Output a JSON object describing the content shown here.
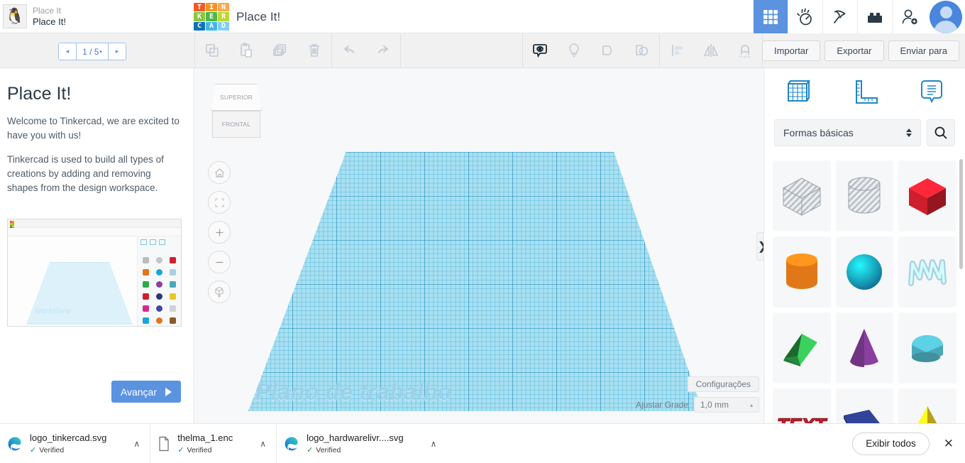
{
  "header": {
    "project_owner": "Place It",
    "project_name": "Place It!",
    "brand_letters": [
      "T",
      "I",
      "N",
      "K",
      "E",
      "R",
      "C",
      "A",
      "D"
    ],
    "brand_colors": [
      "#f15a29",
      "#f7941e",
      "#f9a94b",
      "#8cc63f",
      "#4db848",
      "#bed630",
      "#0d72b9",
      "#41b6e6",
      "#7fd0f0"
    ],
    "brand_title": "Place It!",
    "icons": [
      {
        "name": "grid-apps-icon",
        "active": true
      },
      {
        "name": "circuits-icon",
        "active": false
      },
      {
        "name": "codeblocks-pickaxe-icon",
        "active": false
      },
      {
        "name": "brick-icon",
        "active": false
      },
      {
        "name": "add-user-icon",
        "active": false
      },
      {
        "name": "user-avatar",
        "active": false
      }
    ]
  },
  "toolbar": {
    "pager": {
      "prev": "◂",
      "label": "1 / 5",
      "caret": "▾",
      "next": "▸"
    },
    "left_tools": [
      "copy-icon",
      "paste-icon",
      "duplicate-icon",
      "delete-icon"
    ],
    "history_tools": [
      "undo-icon",
      "redo-icon"
    ],
    "right_tools": [
      "show-hide-eye-icon",
      "lightbulb-icon",
      "group-icon",
      "ungroup-icon",
      "align-icon",
      "mirror-icon",
      "magnet-icon"
    ],
    "import_label": "Importar",
    "export_label": "Exportar",
    "send_to_label": "Enviar para"
  },
  "tutorial": {
    "title": "Place It!",
    "paragraph1": "Welcome to Tinkercad, we are excited to have you with us!",
    "paragraph2": "Tinkercad is used to build all types of creations by adding and removing shapes from the design workspace.",
    "thumbnail_workplane_label": "Workplane",
    "advance_label": "Avançar"
  },
  "canvas": {
    "viewcube_top": "SUPERIOR",
    "viewcube_front": "FRONTAL",
    "nav_buttons": [
      "home-icon",
      "fit-view-icon",
      "zoom-in-icon",
      "zoom-out-icon",
      "orthographic-view-icon"
    ],
    "workplane_label": "Plano de trabalho",
    "settings_label": "Configurações",
    "grid_label": "Ajustar Grade",
    "grid_value": "1,0 mm",
    "grid_caret": "▴",
    "grid_color": "#a9e0f2"
  },
  "right_panel": {
    "tabs": [
      "workplane-grid-icon",
      "ruler-icon",
      "notes-icon"
    ],
    "category_value": "Formas básicas",
    "search_icon": "search-icon",
    "collapse_icon": "❯",
    "shapes": [
      {
        "name": "box-hole",
        "color": "#c9cdd1",
        "kind": "box",
        "hatched": true
      },
      {
        "name": "cylinder-hole",
        "color": "#c9cdd1",
        "kind": "cylinder",
        "hatched": true
      },
      {
        "name": "box-red",
        "color": "#cf1f2e",
        "kind": "box",
        "hatched": false
      },
      {
        "name": "cylinder-orange",
        "color": "#e07818",
        "kind": "cylinder",
        "hatched": false
      },
      {
        "name": "sphere-blue",
        "color": "#18a6d8",
        "kind": "sphere",
        "hatched": false
      },
      {
        "name": "scribble-lightblue",
        "color": "#a8cfe3",
        "kind": "scribble",
        "hatched": false
      },
      {
        "name": "roof-green",
        "color": "#2ea84a",
        "kind": "roof",
        "hatched": false
      },
      {
        "name": "cone-purple",
        "color": "#8a3fa0",
        "kind": "cone",
        "hatched": false
      },
      {
        "name": "halfcylinder-teal",
        "color": "#4aa8b8",
        "kind": "halfcyl",
        "hatched": false
      },
      {
        "name": "text-red",
        "color": "#cf1f2e",
        "kind": "text",
        "hatched": false
      },
      {
        "name": "wedge-navy",
        "color": "#27367a",
        "kind": "wedge",
        "hatched": false
      },
      {
        "name": "pyramid-yellow",
        "color": "#e8c81e",
        "kind": "pyramid",
        "hatched": false
      }
    ]
  },
  "downloads": {
    "items": [
      {
        "file": "logo_tinkercad.svg",
        "status": "Verified",
        "icon": "edge-browser-icon"
      },
      {
        "file": "thelma_1.enc",
        "status": "Verified",
        "icon": "generic-file-icon"
      },
      {
        "file": "logo_hardwarelivr....svg",
        "status": "Verified",
        "icon": "edge-browser-icon"
      }
    ],
    "check_glyph": "✓",
    "caret_glyph": "∧",
    "show_all_label": "Exibir todos",
    "close_glyph": "✕"
  }
}
